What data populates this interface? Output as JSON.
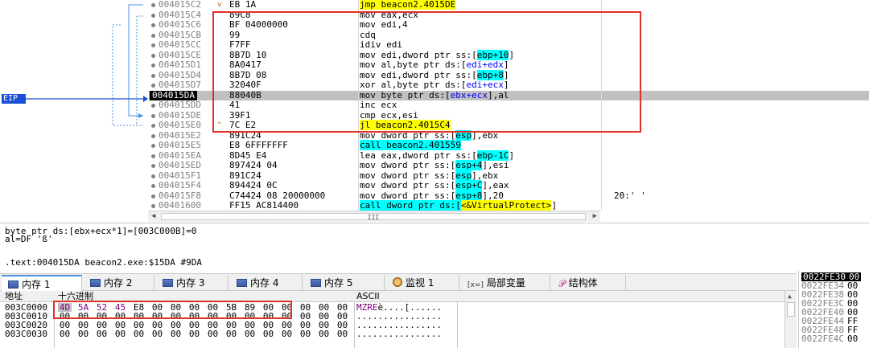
{
  "disasm_rows": [
    {
      "addr": "004015C2",
      "jmark": "v",
      "bytes": "EB 1A",
      "instr": [
        {
          "t": "jmp beacon2.4015DE",
          "c": "y"
        }
      ],
      "cmt": ""
    },
    {
      "addr": "004015C4",
      "jmark": "",
      "bytes": "89C8",
      "instr": [
        {
          "t": "mov eax,ecx"
        }
      ],
      "cmt": ""
    },
    {
      "addr": "004015C6",
      "jmark": "",
      "bytes": "BF 04000000",
      "instr": [
        {
          "t": "mov edi,4"
        }
      ],
      "cmt": ""
    },
    {
      "addr": "004015CB",
      "jmark": "",
      "bytes": "99",
      "instr": [
        {
          "t": "cdq"
        }
      ],
      "cmt": ""
    },
    {
      "addr": "004015CC",
      "jmark": "",
      "bytes": "F7FF",
      "instr": [
        {
          "t": "idiv edi"
        }
      ],
      "cmt": ""
    },
    {
      "addr": "004015CE",
      "jmark": "",
      "bytes": "8B7D 10",
      "instr": [
        {
          "t": "mov edi,dword ptr ss:["
        },
        {
          "t": "ebp+10",
          "c": "c"
        },
        {
          "t": "]"
        }
      ],
      "cmt": ""
    },
    {
      "addr": "004015D1",
      "jmark": "",
      "bytes": "8A0417",
      "instr": [
        {
          "t": "mov al,byte ptr ds:["
        },
        {
          "t": "edi+edx",
          "c": "b"
        },
        {
          "t": "]"
        }
      ],
      "cmt": ""
    },
    {
      "addr": "004015D4",
      "jmark": "",
      "bytes": "8B7D 08",
      "instr": [
        {
          "t": "mov edi,dword ptr ss:["
        },
        {
          "t": "ebp+8",
          "c": "c"
        },
        {
          "t": "]"
        }
      ],
      "cmt": ""
    },
    {
      "addr": "004015D7",
      "jmark": "",
      "bytes": "32040F",
      "instr": [
        {
          "t": "xor al,byte ptr ds:["
        },
        {
          "t": "edi+ecx",
          "c": "b"
        },
        {
          "t": "]"
        }
      ],
      "cmt": ""
    },
    {
      "addr": "004015DA",
      "jmark": "",
      "bytes": "88040B",
      "instr": [
        {
          "t": "mov byte ptr ds:["
        },
        {
          "t": "ebx+ecx",
          "c": "b"
        },
        {
          "t": "],al"
        }
      ],
      "cmt": "",
      "eip": true
    },
    {
      "addr": "004015DD",
      "jmark": "",
      "bytes": "41",
      "instr": [
        {
          "t": "inc ecx"
        }
      ],
      "cmt": ""
    },
    {
      "addr": "004015DE",
      "jmark": "",
      "bytes": "39F1",
      "instr": [
        {
          "t": "cmp ecx,esi"
        }
      ],
      "cmt": ""
    },
    {
      "addr": "004015E0",
      "jmark": "^",
      "bytes": "7C E2",
      "instr": [
        {
          "t": "jl beacon2.4015C4",
          "c": "y"
        }
      ],
      "cmt": ""
    },
    {
      "addr": "004015E2",
      "jmark": "",
      "bytes": "891C24",
      "instr": [
        {
          "t": "mov dword ptr ss:["
        },
        {
          "t": "esp",
          "c": "c"
        },
        {
          "t": "],ebx"
        }
      ],
      "cmt": ""
    },
    {
      "addr": "004015E5",
      "jmark": "",
      "bytes": "E8 6FFFFFFF",
      "instr": [
        {
          "t": "call beacon2.401559",
          "c": "c"
        }
      ],
      "cmt": ""
    },
    {
      "addr": "004015EA",
      "jmark": "",
      "bytes": "8D45 E4",
      "instr": [
        {
          "t": "lea eax,dword ptr ss:["
        },
        {
          "t": "ebp-1C",
          "c": "c"
        },
        {
          "t": "]"
        }
      ],
      "cmt": ""
    },
    {
      "addr": "004015ED",
      "jmark": "",
      "bytes": "897424 04",
      "instr": [
        {
          "t": "mov dword ptr ss:["
        },
        {
          "t": "esp+4",
          "c": "c"
        },
        {
          "t": "],esi"
        }
      ],
      "cmt": ""
    },
    {
      "addr": "004015F1",
      "jmark": "",
      "bytes": "891C24",
      "instr": [
        {
          "t": "mov dword ptr ss:["
        },
        {
          "t": "esp",
          "c": "c"
        },
        {
          "t": "],ebx"
        }
      ],
      "cmt": ""
    },
    {
      "addr": "004015F4",
      "jmark": "",
      "bytes": "894424 0C",
      "instr": [
        {
          "t": "mov dword ptr ss:["
        },
        {
          "t": "esp+C",
          "c": "c"
        },
        {
          "t": "],eax"
        }
      ],
      "cmt": ""
    },
    {
      "addr": "004015F8",
      "jmark": "",
      "bytes": "C74424 08 20000000",
      "instr": [
        {
          "t": "mov dword ptr ss:["
        },
        {
          "t": "esp+8",
          "c": "c"
        },
        {
          "t": "],20"
        }
      ],
      "cmt": "20:' '"
    },
    {
      "addr": "00401600",
      "jmark": "",
      "bytes": "FF15 AC814400",
      "instr": [
        {
          "t": "call dword ptr ds:[",
          "c": "c"
        },
        {
          "t": "<&VirtualProtect>",
          "c": "y"
        },
        {
          "t": "]"
        }
      ],
      "cmt": ""
    }
  ],
  "eip_label": "EIP",
  "scroll_grip": "III",
  "info": {
    "line1": "byte ptr ds:[ebx+ecx*1]=[003C000B]=0",
    "line2": "al=DF 'ß'",
    "line3": ".text:004015DA beacon2.exe:$15DA #9DA"
  },
  "tabs": [
    {
      "label": "内存 1",
      "icon": "memory-icon",
      "active": true
    },
    {
      "label": "内存 2",
      "icon": "memory-icon"
    },
    {
      "label": "内存 3",
      "icon": "memory-icon"
    },
    {
      "label": "内存 4",
      "icon": "memory-icon"
    },
    {
      "label": "内存 5",
      "icon": "memory-icon"
    },
    {
      "label": "监视 1",
      "icon": "watch-icon"
    },
    {
      "label": "局部变量",
      "icon": "local-vars-icon",
      "icon_text": "[x=]"
    },
    {
      "label": "结构体",
      "icon": "struct-icon",
      "icon_text": "𝒫"
    }
  ],
  "dump": {
    "col_addr": "地址",
    "col_hex": "十六进制",
    "col_ascii": "ASCII",
    "rows": [
      {
        "addr": "003C0000",
        "bytes": [
          "4D",
          "5A",
          "52",
          "45",
          "E8",
          "00",
          "00",
          "00",
          "00",
          "5B",
          "89",
          "00",
          "00",
          "00",
          "00",
          "00"
        ],
        "ascii": "MZREè....[......",
        "ascii_hl": 4
      },
      {
        "addr": "003C0010",
        "bytes": [
          "00",
          "00",
          "00",
          "00",
          "00",
          "00",
          "00",
          "00",
          "00",
          "00",
          "00",
          "00",
          "00",
          "00",
          "00",
          "00"
        ],
        "ascii": "................"
      },
      {
        "addr": "003C0020",
        "bytes": [
          "00",
          "00",
          "00",
          "00",
          "00",
          "00",
          "00",
          "00",
          "00",
          "00",
          "00",
          "00",
          "00",
          "00",
          "00",
          "00"
        ],
        "ascii": "................"
      },
      {
        "addr": "003C0030",
        "bytes": [
          "00",
          "00",
          "00",
          "00",
          "00",
          "00",
          "00",
          "00",
          "00",
          "00",
          "00",
          "00",
          "00",
          "00",
          "00",
          "00"
        ],
        "ascii": "................"
      }
    ]
  },
  "stack": [
    {
      "addr": "0022FE30",
      "val": "00",
      "top": true
    },
    {
      "addr": "0022FE34",
      "val": "00"
    },
    {
      "addr": "0022FE38",
      "val": "00"
    },
    {
      "addr": "0022FE3C",
      "val": "00"
    },
    {
      "addr": "0022FE40",
      "val": "00"
    },
    {
      "addr": "0022FE44",
      "val": "FF"
    },
    {
      "addr": "0022FE48",
      "val": "FF"
    },
    {
      "addr": "0022FE4C",
      "val": "00"
    }
  ],
  "colors": {
    "highlight_yellow": "#ffff00",
    "highlight_cyan": "#00ffff",
    "eip_blue": "#1a4fd6",
    "annotation_red": "#e0302a"
  }
}
